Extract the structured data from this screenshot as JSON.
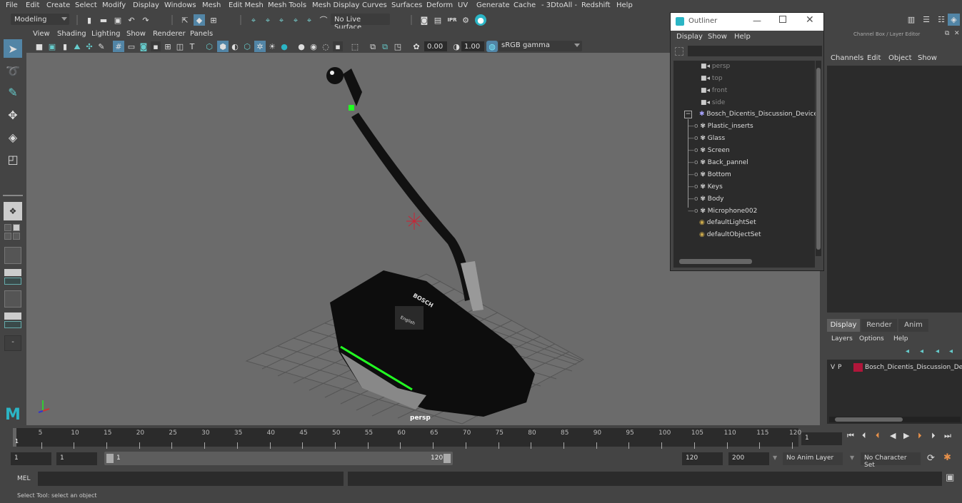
{
  "menubar": {
    "items": [
      "File",
      "Edit",
      "Create",
      "Select",
      "Modify",
      "Display",
      "Windows",
      "Mesh",
      "Edit Mesh",
      "Mesh Tools",
      "Mesh Display",
      "Curves",
      "Surfaces",
      "Deform",
      "UV",
      "Generate",
      "Cache",
      "- 3DtoAll -",
      "Redshift",
      "Help"
    ]
  },
  "shelf": {
    "mode": "Modeling",
    "live_surface": "No Live Surface"
  },
  "viewport": {
    "menu": [
      "View",
      "Shading",
      "Lighting",
      "Show",
      "Renderer",
      "Panels"
    ],
    "exposure": "0.00",
    "gamma": "1.00",
    "color_space": "sRGB gamma",
    "camera_label": "persp",
    "model": {
      "brand": "BOSCH",
      "screen_text": "English"
    }
  },
  "outliner": {
    "title": "Outliner",
    "menu": [
      "Display",
      "Show",
      "Help"
    ],
    "search_value": "",
    "items": [
      {
        "label": "persp",
        "type": "camera",
        "dim": true
      },
      {
        "label": "top",
        "type": "camera",
        "dim": true
      },
      {
        "label": "front",
        "type": "camera",
        "dim": true
      },
      {
        "label": "side",
        "type": "camera",
        "dim": true
      },
      {
        "label": "Bosch_Dicentis_Discussion_Device_",
        "type": "group",
        "expanded": true
      },
      {
        "label": "Plastic_inserts",
        "type": "mesh",
        "child": true
      },
      {
        "label": "Glass",
        "type": "mesh",
        "child": true
      },
      {
        "label": "Screen",
        "type": "mesh",
        "child": true
      },
      {
        "label": "Back_pannel",
        "type": "mesh",
        "child": true
      },
      {
        "label": "Bottom",
        "type": "mesh",
        "child": true
      },
      {
        "label": "Keys",
        "type": "mesh",
        "child": true
      },
      {
        "label": "Body",
        "type": "mesh",
        "child": true
      },
      {
        "label": "Microphone002",
        "type": "mesh",
        "child": true
      },
      {
        "label": "defaultLightSet",
        "type": "set"
      },
      {
        "label": "defaultObjectSet",
        "type": "set"
      }
    ]
  },
  "channelbox": {
    "title": "Channel Box / Layer Editor",
    "menu": [
      "Channels",
      "Edit",
      "Object",
      "Show"
    ],
    "layer_tabs": [
      "Display",
      "Render",
      "Anim"
    ],
    "active_layer_tab": "Display",
    "layer_menu": [
      "Layers",
      "Options",
      "Help"
    ],
    "layers": [
      {
        "v": "V",
        "p": "P",
        "color": "#b0163a",
        "name": "Bosch_Dicentis_Discussion_Dev"
      }
    ]
  },
  "timeline": {
    "ticks": [
      "5",
      "10",
      "15",
      "20",
      "25",
      "30",
      "35",
      "40",
      "45",
      "50",
      "55",
      "60",
      "65",
      "70",
      "75",
      "80",
      "85",
      "90",
      "95",
      "100",
      "105",
      "110",
      "115",
      "120"
    ],
    "current_frame_marker": "1",
    "current_frame": "1"
  },
  "range": {
    "start": "1",
    "playback_start": "1",
    "slider_start": "1",
    "slider_end": "120",
    "playback_end": "120",
    "end": "200",
    "anim_layer": "No Anim Layer",
    "character_set": "No Character Set"
  },
  "command": {
    "label": "MEL",
    "value": ""
  },
  "help_line": "Select Tool: select an object"
}
